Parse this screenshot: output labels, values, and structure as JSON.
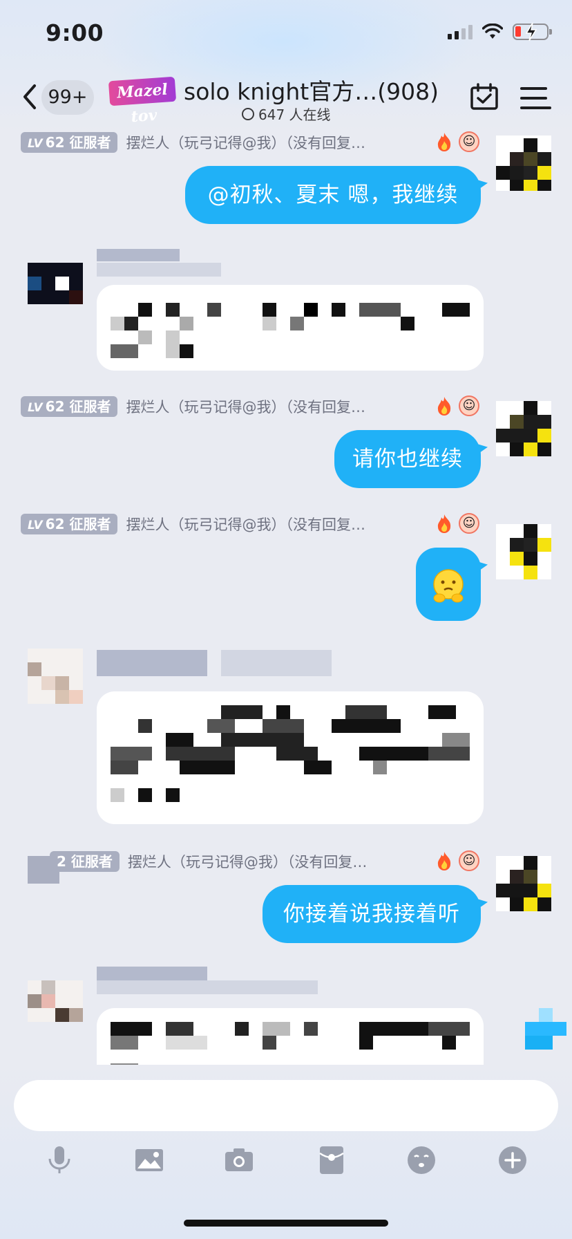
{
  "status_bar": {
    "time": "9:00"
  },
  "header": {
    "unread_count": "99+",
    "group_logo_text": "Mazel tov",
    "group_title": "solo knight官方…(908)",
    "online_text": "647 人在线"
  },
  "sender": {
    "level": "LV 62",
    "level_prefix": "LV",
    "level_number": "62",
    "title_badge": "征服者",
    "name": "摆烂人（玩弓记得@我）（没有回复…",
    "partial_badge_title": "2 征服者"
  },
  "messages": [
    {
      "id": "m1",
      "direction": "out",
      "text": "@初秋、夏末 嗯，我继续"
    },
    {
      "id": "m2",
      "direction": "in",
      "text": ""
    },
    {
      "id": "m3",
      "direction": "out",
      "text": "请你也继续"
    },
    {
      "id": "m4",
      "direction": "out",
      "sticker": "😳"
    },
    {
      "id": "m5",
      "direction": "in",
      "text": ""
    },
    {
      "id": "m6",
      "direction": "out",
      "text": "你接着说我接着听"
    },
    {
      "id": "m7",
      "direction": "in",
      "text": ""
    }
  ],
  "input": {
    "placeholder": ""
  },
  "toolbar": {
    "icons": [
      "microphone-icon",
      "image-icon",
      "camera-icon",
      "red-packet-icon",
      "emoji-icon",
      "plus-icon"
    ]
  },
  "colors": {
    "accent_bubble": "#20b1f7",
    "background": "#e9ebf2",
    "level_badge": "#a9aec0"
  }
}
